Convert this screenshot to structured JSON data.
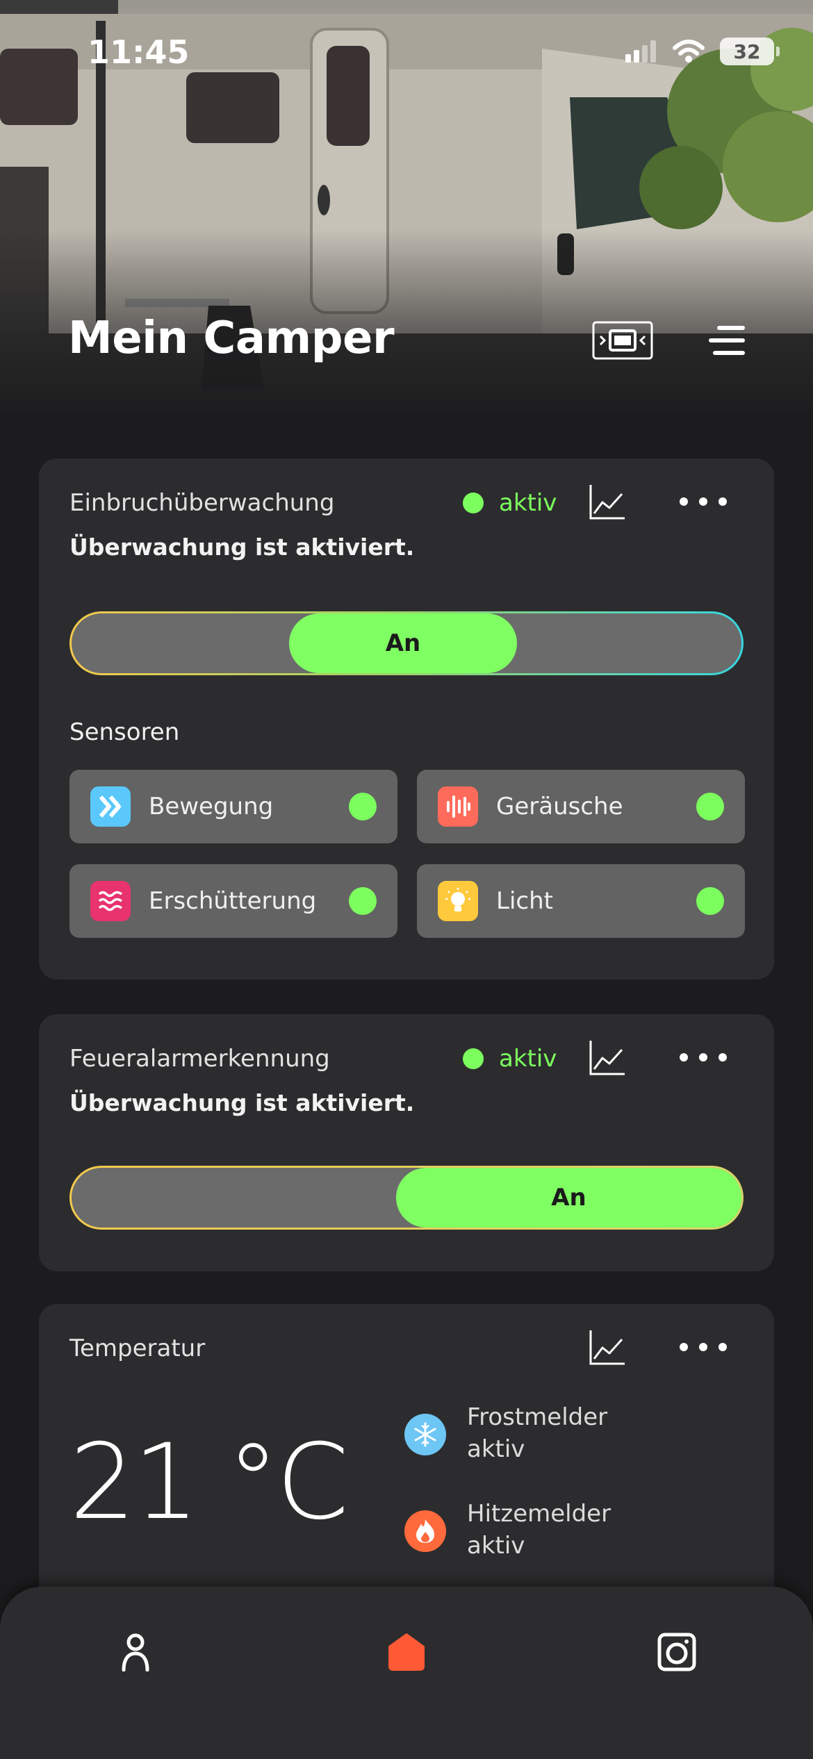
{
  "status_bar": {
    "time": "11:45",
    "battery": "32"
  },
  "header": {
    "title": "Mein Camper"
  },
  "intrusion": {
    "title": "Einbruchüberwachung",
    "status": "aktiv",
    "subtitle": "Überwachung ist aktiviert.",
    "toggle_label": "An",
    "sensors_label": "Sensoren",
    "sensors": [
      {
        "label": "Bewegung",
        "icon": "motion-icon",
        "color": "#5ac8fa",
        "active": true
      },
      {
        "label": "Geräusche",
        "icon": "sound-icon",
        "color": "#ff6b5b",
        "active": true
      },
      {
        "label": "Erschütterung",
        "icon": "vibration-icon",
        "color": "#e8336e",
        "active": true
      },
      {
        "label": "Licht",
        "icon": "light-bulb-icon",
        "color": "#ffc93c",
        "active": true
      }
    ]
  },
  "fire": {
    "title": "Feueralarmerkennung",
    "status": "aktiv",
    "subtitle": "Überwachung ist aktiviert.",
    "toggle_label": "An"
  },
  "temperature": {
    "title": "Temperatur",
    "value": "21 °C",
    "alarms": [
      {
        "label": "Frostmelder",
        "status": "aktiv",
        "icon": "snowflake-icon",
        "color": "#6ec6f5"
      },
      {
        "label": "Hitzemelder",
        "status": "aktiv",
        "icon": "flame-icon",
        "color": "#ff6a3d"
      }
    ]
  },
  "nav": {
    "items": [
      "profile-icon",
      "home-icon",
      "camera-icon"
    ],
    "active_color": "#ff5a36"
  },
  "colors": {
    "accent_green": "#7cff5e",
    "card_bg": "#2c2c2e",
    "page_bg": "#1c1c1e"
  }
}
